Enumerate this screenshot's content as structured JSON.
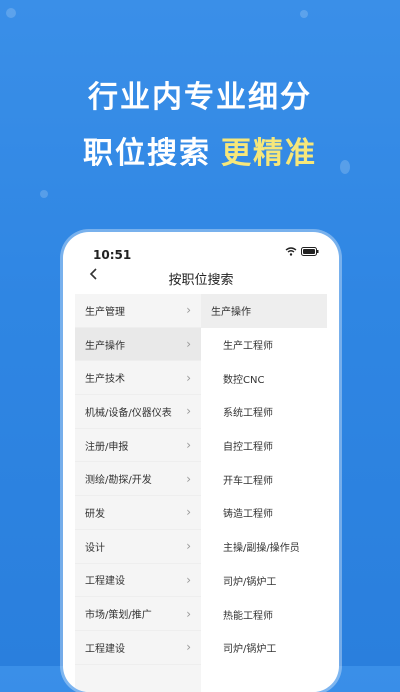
{
  "headline": {
    "line1": "行业内专业细分",
    "line2_main": "职位搜索",
    "line2_accent": "更精准"
  },
  "status": {
    "time": "10:51"
  },
  "nav": {
    "title": "按职位搜索",
    "back_icon": "chevron-left-icon"
  },
  "categories": [
    "生产管理",
    "生产操作",
    "生产技术",
    "机械/设备/仪器仪表",
    "注册/申报",
    "测绘/勘探/开发",
    "研发",
    "设计",
    "工程建设",
    "市场/策划/推广",
    "工程建设"
  ],
  "selected_category": "生产操作",
  "subcategories": [
    "生产工程师",
    "数控CNC",
    "系统工程师",
    "自控工程师",
    "开车工程师",
    "铸造工程师",
    "主操/副操/操作员",
    "司炉/锅炉工",
    "热能工程师",
    "司炉/锅炉工"
  ],
  "colors": {
    "background": "#2f86e3",
    "accent_text": "#f6e77a"
  }
}
